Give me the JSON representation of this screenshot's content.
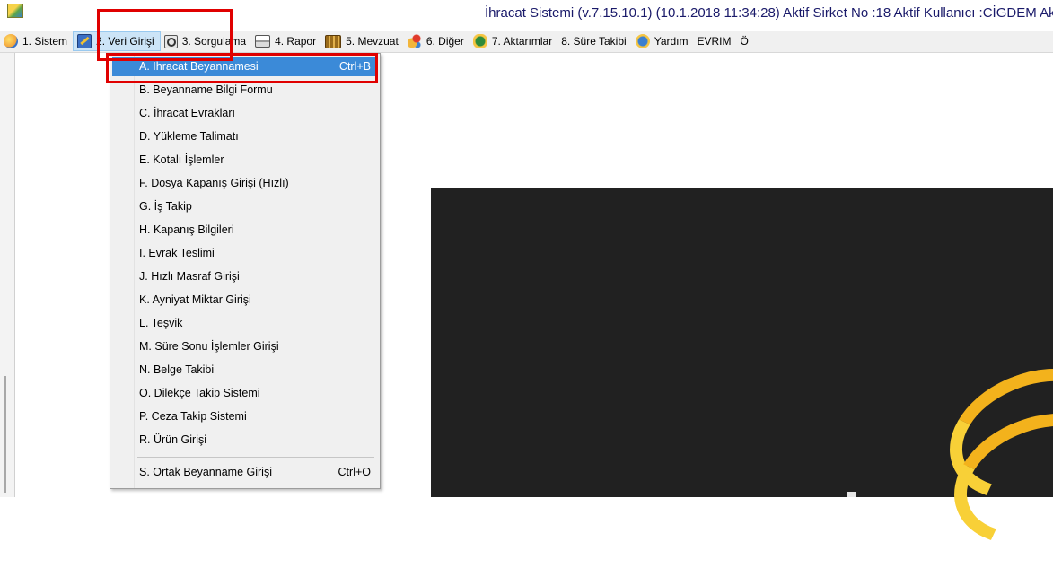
{
  "window": {
    "title": "İhracat Sistemi (v.7.15.10.1) (10.1.2018 11:34:28) Aktif Sirket No :18 Aktif Kullanıcı :CİGDEM Akt"
  },
  "menubar": {
    "items": [
      {
        "label": "1. Sistem",
        "icon": "sistem-icon"
      },
      {
        "label": "2. Veri Girişi",
        "icon": "veri-girisi-icon"
      },
      {
        "label": "3. Sorgulama",
        "icon": "sorgulama-icon"
      },
      {
        "label": "4. Rapor",
        "icon": "rapor-icon"
      },
      {
        "label": "5. Mevzuat",
        "icon": "mevzuat-icon"
      },
      {
        "label": "6. Diğer",
        "icon": "diger-icon"
      },
      {
        "label": "7. Aktarımlar",
        "icon": "aktarimlar-icon"
      },
      {
        "label": "8. Süre Takibi",
        "icon": ""
      },
      {
        "label": "Yardım",
        "icon": "yardim-icon"
      },
      {
        "label": "EVRIM",
        "icon": ""
      },
      {
        "label": "Ö",
        "icon": ""
      }
    ],
    "active_index": 1
  },
  "dropdown": {
    "items": [
      {
        "label": "A.  İhracat Beyannamesi",
        "shortcut": "Ctrl+B",
        "selected": true
      },
      {
        "label": "B.  Beyanname Bilgi Formu"
      },
      {
        "label": "C.  İhracat Evrakları"
      },
      {
        "label": "D.  Yükleme Talimatı"
      },
      {
        "label": "E.  Kotalı İşlemler"
      },
      {
        "label": "F.  Dosya Kapanış Girişi (Hızlı)"
      },
      {
        "label": "G.  İş Takip"
      },
      {
        "label": "H.  Kapanış Bilgileri"
      },
      {
        "label": "I.  Evrak Teslimi"
      },
      {
        "label": "J.  Hızlı Masraf Girişi"
      },
      {
        "label": "K.  Ayniyat Miktar Girişi"
      },
      {
        "label": "L.  Teşvik"
      },
      {
        "label": "M.  Süre Sonu İşlemler Girişi"
      },
      {
        "label": "N.  Belge Takibi"
      },
      {
        "label": "O.  Dilekçe Takip Sistemi"
      },
      {
        "label": "P.  Ceza Takip Sistemi"
      },
      {
        "label": "R.  Ürün Girişi"
      },
      {
        "label": "S.  Ortak Beyanname Girişi",
        "shortcut": "Ctrl+O"
      }
    ]
  },
  "colors": {
    "menu_highlight": "#cce4f7",
    "selected_item": "#3b8ad8",
    "annotation_red": "#e00000",
    "splash_bg": "#212121",
    "swoosh": "#f3b21c"
  }
}
